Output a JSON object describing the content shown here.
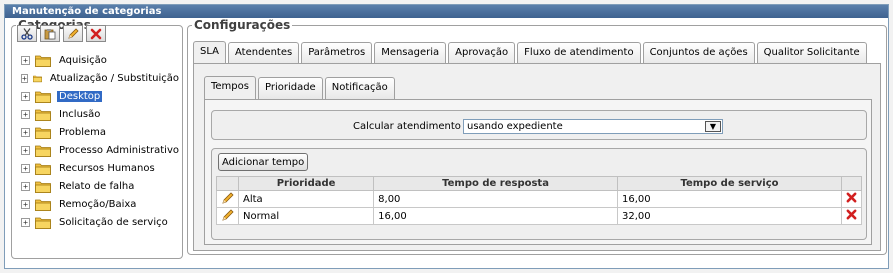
{
  "window": {
    "title": "Manutenção de categorias"
  },
  "categories": {
    "legend": "Categorias",
    "toolbar": [
      {
        "name": "cut-icon",
        "title": "scissors"
      },
      {
        "name": "paste-icon",
        "title": "clipboard"
      },
      {
        "name": "edit-icon",
        "title": "pencil"
      },
      {
        "name": "delete-icon",
        "title": "red-x"
      }
    ],
    "items": [
      {
        "label": "Aquisição",
        "selected": false
      },
      {
        "label": "Atualização / Substituição",
        "selected": false
      },
      {
        "label": "Desktop",
        "selected": true
      },
      {
        "label": "Inclusão",
        "selected": false
      },
      {
        "label": "Problema",
        "selected": false
      },
      {
        "label": "Processo Administrativo",
        "selected": false
      },
      {
        "label": "Recursos Humanos",
        "selected": false
      },
      {
        "label": "Relato de falha",
        "selected": false
      },
      {
        "label": "Remoção/Baixa",
        "selected": false
      },
      {
        "label": "Solicitação de serviço",
        "selected": false
      }
    ]
  },
  "config": {
    "legend": "Configurações",
    "tabs": [
      "SLA",
      "Atendentes",
      "Parâmetros",
      "Mensageria",
      "Aprovação",
      "Fluxo de atendimento",
      "Conjuntos de ações",
      "Qualitor Solicitante"
    ],
    "active_tab": 0,
    "sub_tabs": [
      "Tempos",
      "Prioridade",
      "Notificação"
    ],
    "active_sub_tab": 0,
    "calc_label": "Calcular atendimento :",
    "calc_value": "usando expediente",
    "add_button": "Adicionar tempo",
    "table": {
      "headers": [
        "Prioridade",
        "Tempo de resposta",
        "Tempo de serviço"
      ],
      "rows": [
        [
          "Alta",
          "8,00",
          "16,00"
        ],
        [
          "Normal",
          "16,00",
          "32,00"
        ]
      ]
    }
  },
  "colors": {
    "titlebar": "#3e6290",
    "selection": "#316ac5",
    "folder": "#f0c040",
    "delete": "#d22020"
  }
}
